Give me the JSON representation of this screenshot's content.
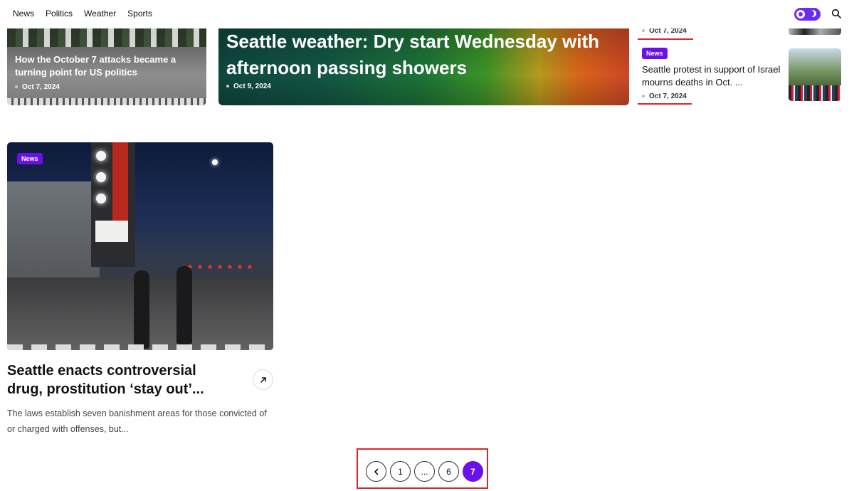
{
  "nav": {
    "items": [
      "News",
      "Politics",
      "Weather",
      "Sports"
    ]
  },
  "top_cards": {
    "left": {
      "title": "How the October 7 attacks became a turning point for US politics",
      "date": "Oct 7, 2024"
    },
    "center": {
      "title": "Seattle weather: Dry start Wednesday with afternoon passing showers",
      "date": "Oct 9, 2024"
    }
  },
  "sidebar": {
    "item1_date": "Oct 7, 2024",
    "item2": {
      "badge": "News",
      "title": "Seattle protest in support of Israel mourns deaths in Oct. ...",
      "date": "Oct 7, 2024"
    }
  },
  "article": {
    "badge": "News",
    "title": "Seattle enacts controversial drug, prostitution ‘stay out’...",
    "excerpt": "The laws establish seven banishment areas for those convicted of or charged with offenses, but..."
  },
  "pagination": {
    "pages": [
      "1",
      "...",
      "6",
      "7"
    ],
    "current": "7"
  },
  "colors": {
    "accent": "#6a10e8",
    "highlight": "#d8262e"
  }
}
